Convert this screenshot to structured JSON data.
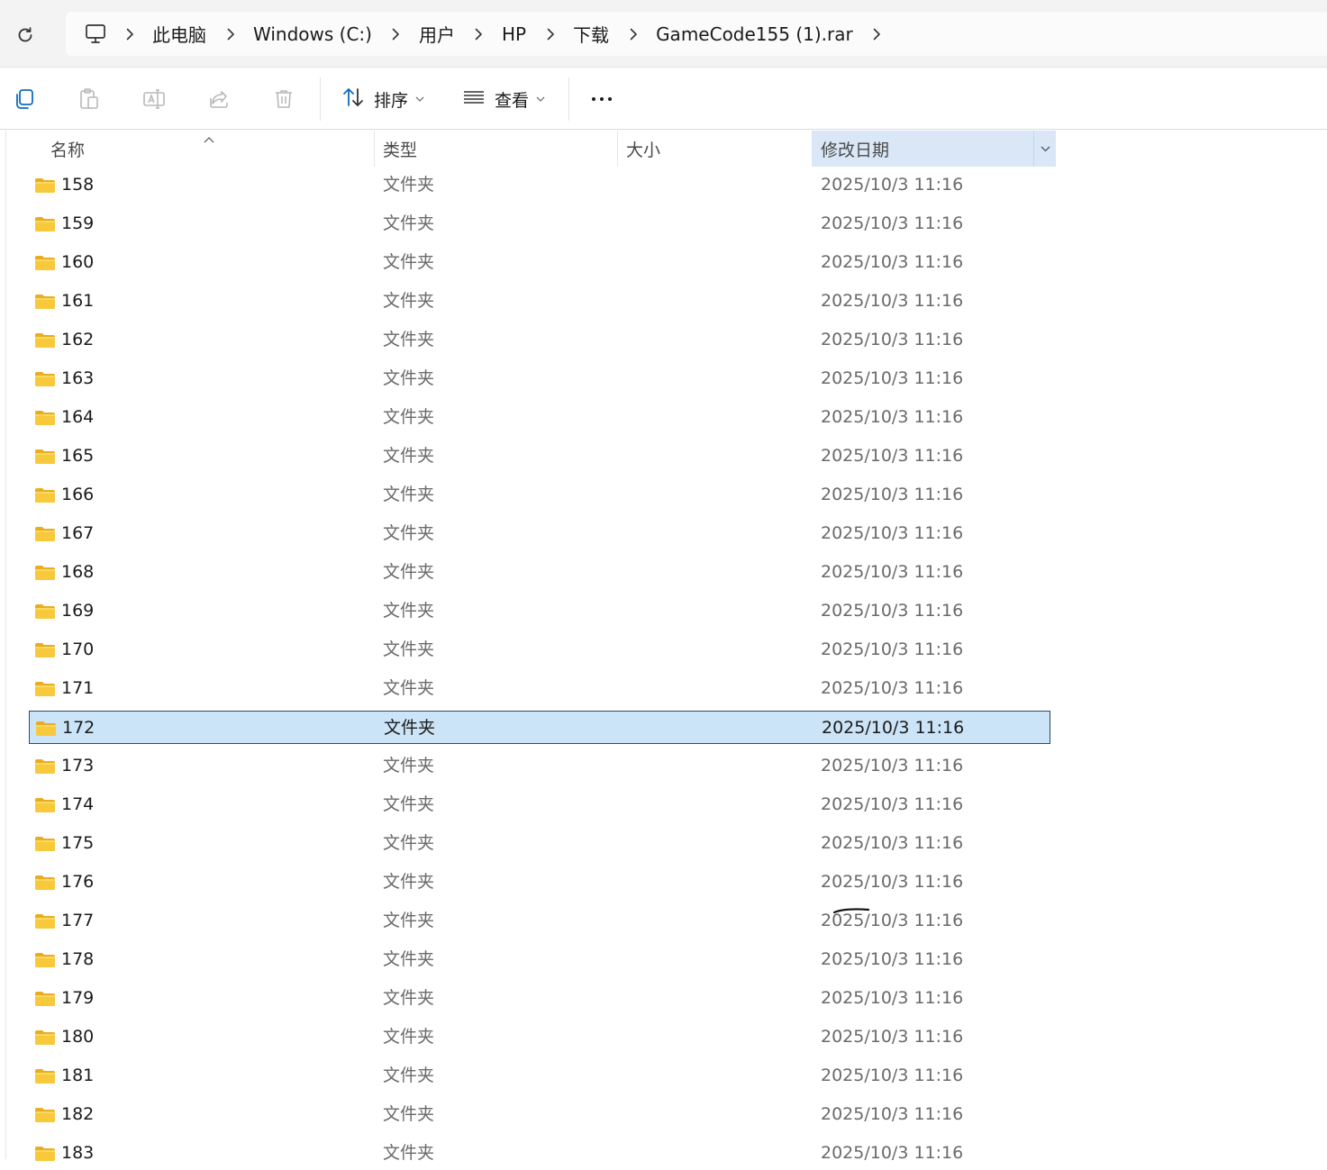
{
  "address_bar": {
    "refresh_icon": "refresh-icon",
    "computer_icon": "computer-icon",
    "breadcrumbs": [
      "此电脑",
      "Windows (C:)",
      "用户",
      "HP",
      "下载",
      "GameCode155 (1).rar"
    ]
  },
  "toolbar": {
    "icons": [
      "copy-icon",
      "paste-icon",
      "rename-icon",
      "share-icon",
      "delete-icon"
    ],
    "sort_label": "排序",
    "view_label": "查看"
  },
  "columns": {
    "name": "名称",
    "type": "类型",
    "size": "大小",
    "date": "修改日期",
    "sorted_column": "修改日期"
  },
  "rows": [
    {
      "name": "158",
      "type": "文件夹",
      "size": "",
      "date": "2025/10/3 11:16"
    },
    {
      "name": "159",
      "type": "文件夹",
      "size": "",
      "date": "2025/10/3 11:16"
    },
    {
      "name": "160",
      "type": "文件夹",
      "size": "",
      "date": "2025/10/3 11:16"
    },
    {
      "name": "161",
      "type": "文件夹",
      "size": "",
      "date": "2025/10/3 11:16"
    },
    {
      "name": "162",
      "type": "文件夹",
      "size": "",
      "date": "2025/10/3 11:16"
    },
    {
      "name": "163",
      "type": "文件夹",
      "size": "",
      "date": "2025/10/3 11:16"
    },
    {
      "name": "164",
      "type": "文件夹",
      "size": "",
      "date": "2025/10/3 11:16"
    },
    {
      "name": "165",
      "type": "文件夹",
      "size": "",
      "date": "2025/10/3 11:16"
    },
    {
      "name": "166",
      "type": "文件夹",
      "size": "",
      "date": "2025/10/3 11:16"
    },
    {
      "name": "167",
      "type": "文件夹",
      "size": "",
      "date": "2025/10/3 11:16"
    },
    {
      "name": "168",
      "type": "文件夹",
      "size": "",
      "date": "2025/10/3 11:16"
    },
    {
      "name": "169",
      "type": "文件夹",
      "size": "",
      "date": "2025/10/3 11:16"
    },
    {
      "name": "170",
      "type": "文件夹",
      "size": "",
      "date": "2025/10/3 11:16"
    },
    {
      "name": "171",
      "type": "文件夹",
      "size": "",
      "date": "2025/10/3 11:16"
    },
    {
      "name": "172",
      "type": "文件夹",
      "size": "",
      "date": "2025/10/3 11:16",
      "selected": true
    },
    {
      "name": "173",
      "type": "文件夹",
      "size": "",
      "date": "2025/10/3 11:16"
    },
    {
      "name": "174",
      "type": "文件夹",
      "size": "",
      "date": "2025/10/3 11:16"
    },
    {
      "name": "175",
      "type": "文件夹",
      "size": "",
      "date": "2025/10/3 11:16"
    },
    {
      "name": "176",
      "type": "文件夹",
      "size": "",
      "date": "2025/10/3 11:16"
    },
    {
      "name": "177",
      "type": "文件夹",
      "size": "",
      "date": "2025/10/3 11:16"
    },
    {
      "name": "178",
      "type": "文件夹",
      "size": "",
      "date": "2025/10/3 11:16"
    },
    {
      "name": "179",
      "type": "文件夹",
      "size": "",
      "date": "2025/10/3 11:16"
    },
    {
      "name": "180",
      "type": "文件夹",
      "size": "",
      "date": "2025/10/3 11:16"
    },
    {
      "name": "181",
      "type": "文件夹",
      "size": "",
      "date": "2025/10/3 11:16"
    },
    {
      "name": "182",
      "type": "文件夹",
      "size": "",
      "date": "2025/10/3 11:16"
    },
    {
      "name": "183",
      "type": "文件夹",
      "size": "",
      "date": "2025/10/3 11:16"
    }
  ],
  "colors": {
    "selected_row_bg": "#cce4f7",
    "selected_row_border": "#2a4b6a",
    "sorted_header_bg": "#d9e7f7",
    "folder_yellow": "#f8c93b",
    "accent_blue": "#0f6cbd"
  }
}
